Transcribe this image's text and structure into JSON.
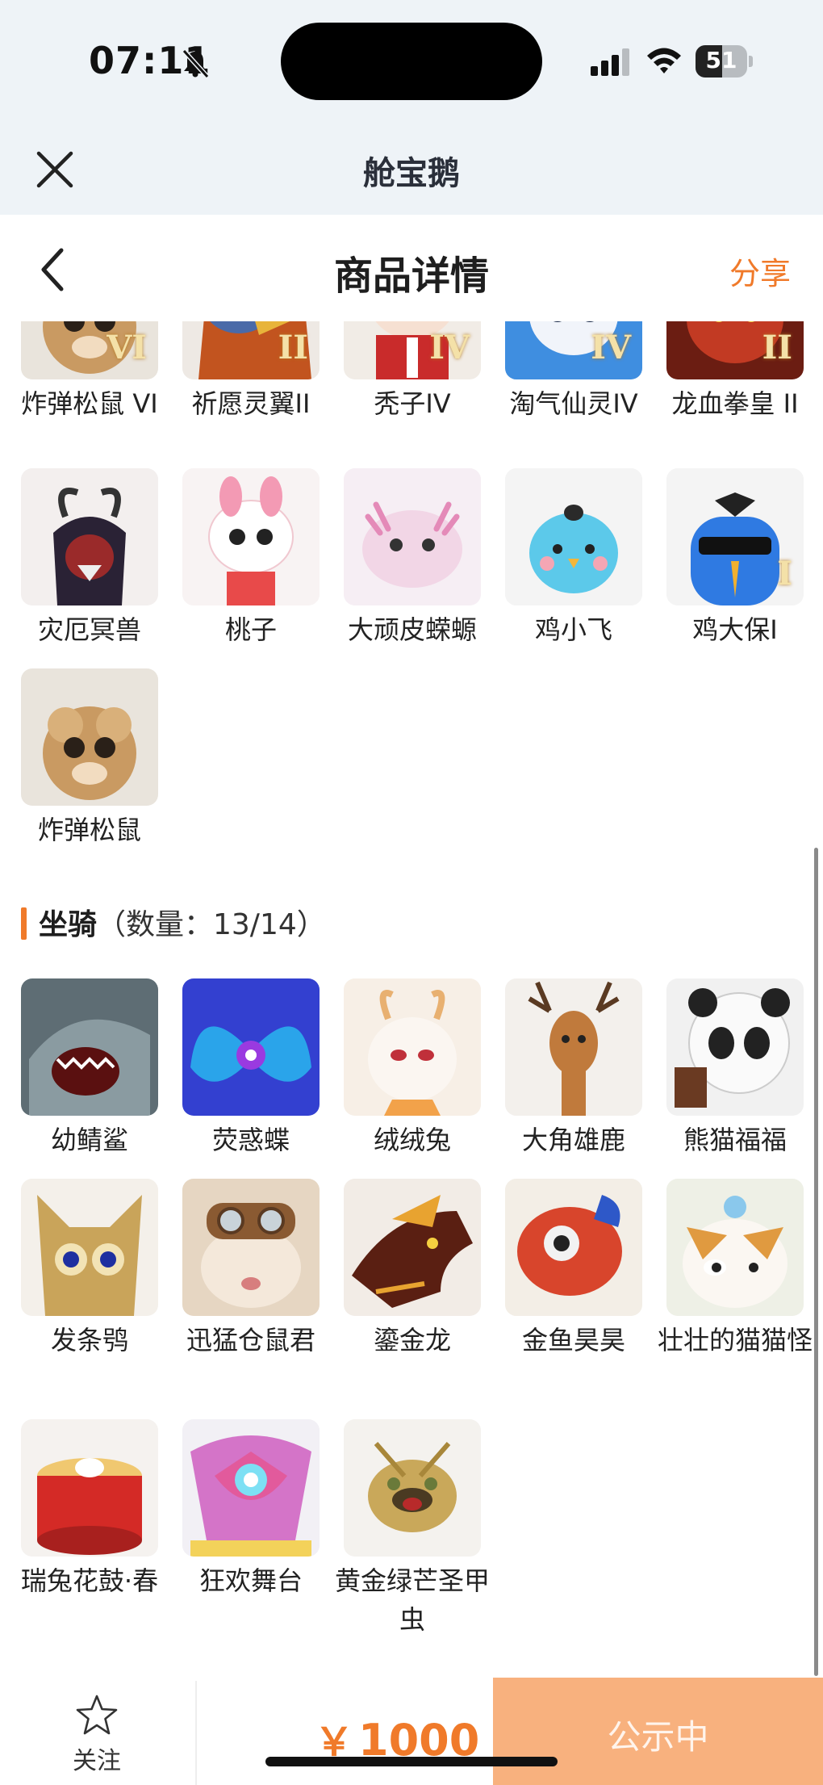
{
  "status_bar": {
    "time": "07:11",
    "battery_level": "51",
    "icons": [
      "bell-muted-icon",
      "cellular-signal-icon",
      "wifi-icon",
      "battery-icon"
    ]
  },
  "app_bar": {
    "title": "舱宝鹅",
    "close_icon": "close-icon"
  },
  "page_header": {
    "title": "商品详情",
    "back_icon": "chevron-left-icon",
    "share_label": "分享"
  },
  "skins_tail": {
    "rows": [
      [
        {
          "name": "炸弹松鼠 VI",
          "rank": "VI",
          "art": "squirrel"
        },
        {
          "name": "祈愿灵翼II",
          "rank": "II",
          "art": "eagle"
        },
        {
          "name": "秃子IV",
          "rank": "IV",
          "art": "bald"
        },
        {
          "name": "淘气仙灵IV",
          "rank": "IV",
          "art": "blue-dog"
        },
        {
          "name": "龙血拳皇 II",
          "rank": "II",
          "art": "red-demon"
        }
      ],
      [
        {
          "name": "灾厄冥兽",
          "rank": "",
          "art": "dark-beast"
        },
        {
          "name": "桃子",
          "rank": "",
          "art": "pink-bunny"
        },
        {
          "name": "大顽皮蝾螈",
          "rank": "",
          "art": "axolotl"
        },
        {
          "name": "鸡小飞",
          "rank": "",
          "art": "blue-chick"
        },
        {
          "name": "鸡大保I",
          "rank": "I",
          "art": "blue-bird-glasses"
        }
      ],
      [
        {
          "name": "炸弹松鼠",
          "rank": "",
          "art": "squirrel"
        }
      ]
    ]
  },
  "mounts": {
    "title": "坐骑",
    "count_label": "（数量：13/14）",
    "rows": [
      [
        {
          "name": "幼鲭鲨",
          "art": "shark"
        },
        {
          "name": "荧惑蝶",
          "art": "blue-butterfly"
        },
        {
          "name": "绒绒兔",
          "art": "white-rabbit"
        },
        {
          "name": "大角雄鹿",
          "art": "deer"
        },
        {
          "name": "熊猫福福",
          "art": "panda"
        }
      ],
      [
        {
          "name": "发条鸮",
          "art": "owl"
        },
        {
          "name": "迅猛仓鼠君",
          "art": "hamster"
        },
        {
          "name": "鎏金龙",
          "art": "gold-dragon"
        },
        {
          "name": "金鱼昊昊",
          "art": "goldfish"
        },
        {
          "name": "壮壮的猫猫怪",
          "art": "cat"
        }
      ],
      [
        {
          "name": "瑞兔花鼓·春",
          "art": "drum"
        },
        {
          "name": "狂欢舞台",
          "art": "stage"
        },
        {
          "name": "黄金绿芒圣甲虫",
          "art": "beetle"
        }
      ]
    ]
  },
  "bottom_bar": {
    "follow_label": "关注",
    "follow_icon": "star-outline-icon",
    "currency_symbol": "￥",
    "price": "1000",
    "status_label": "公示中"
  },
  "colors": {
    "accent": "#f07a2a",
    "status_button": "#f8b17e",
    "top_bar_bg": "#eef3f7"
  }
}
